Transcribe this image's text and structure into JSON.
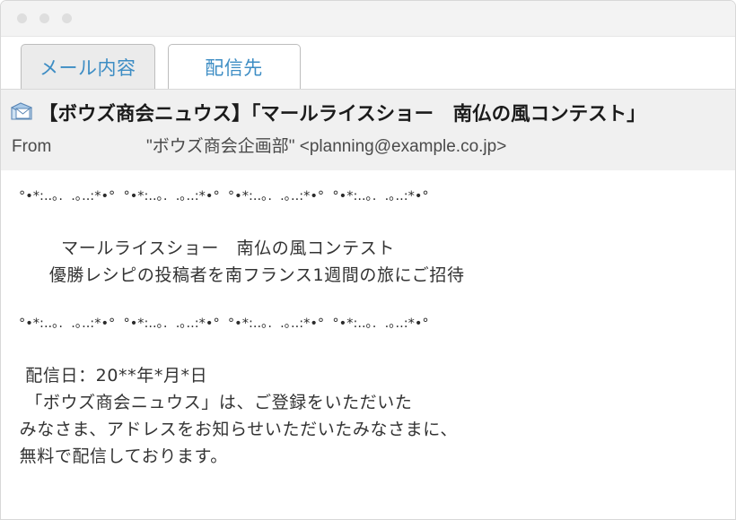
{
  "window": {
    "traffic_lights": [
      "close-dot",
      "minimize-dot",
      "maximize-dot"
    ]
  },
  "tabs": [
    {
      "label": "メール内容",
      "active": true
    },
    {
      "label": "配信先",
      "active": false
    }
  ],
  "mail": {
    "icon": "mail-envelope-icon",
    "subject": "【ボウズ商会ニュウス】「マールライスショー　南仏の風コンテスト」",
    "from_label": "From",
    "from_value": "\"ボウズ商会企画部\" <planning@example.co.jp>",
    "body": {
      "divider_top": "°•*:..｡.  .｡..:*•°  °•*:..｡.  .｡..:*•°  °•*:..｡.  .｡..:*•°  °•*:..｡.  .｡..:*•°",
      "headline_1": "        マールライスショー　南仏の風コンテスト",
      "headline_2": "      優勝レシピの投稿者を南フランス1週間の旅にご招待",
      "divider_mid": "°•*:..｡.  .｡..:*•°  °•*:..｡.  .｡..:*•°  °•*:..｡.  .｡..:*•°  °•*:..｡.  .｡..:*•°",
      "para_line_1": "  配信日：20**年*月*日",
      "para_line_2": "  「ボウズ商会ニュウス」は、ご登録をいただいた",
      "para_line_3": " みなさま、アドレスをお知らせいただいたみなさまに、",
      "para_line_4": " 無料で配信しております。"
    }
  },
  "colors": {
    "tab_text": "#3d8dc4",
    "tab_active_bg": "#ebebeb",
    "header_bg": "#f0f0f0",
    "titlebar_bg": "#f3f3f3",
    "body_text": "#333333",
    "subject_text": "#1b1b1b"
  }
}
